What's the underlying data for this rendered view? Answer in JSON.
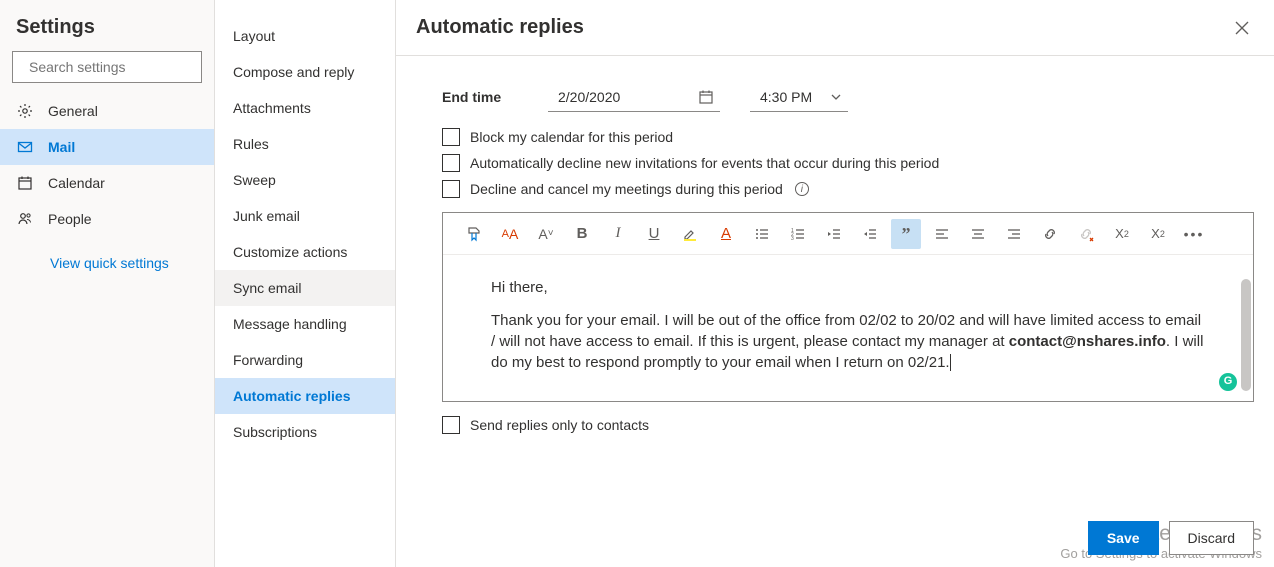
{
  "panel_left": {
    "title": "Settings",
    "search_placeholder": "Search settings",
    "categories": [
      {
        "label": "General"
      },
      {
        "label": "Mail"
      },
      {
        "label": "Calendar"
      },
      {
        "label": "People"
      }
    ],
    "quick_link": "View quick settings"
  },
  "panel_mid": {
    "items": [
      "Layout",
      "Compose and reply",
      "Attachments",
      "Rules",
      "Sweep",
      "Junk email",
      "Customize actions",
      "Sync email",
      "Message handling",
      "Forwarding",
      "Automatic replies",
      "Subscriptions"
    ]
  },
  "main": {
    "title": "Automatic replies",
    "end_label": "End time",
    "end_date": "2/20/2020",
    "end_time": "4:30 PM",
    "checks": {
      "block": "Block my calendar for this period",
      "decline_new": "Automatically decline new invitations for events that occur during this period",
      "decline_cancel": "Decline and cancel my meetings during this period"
    },
    "message": {
      "greeting": "Hi there,",
      "body1": "Thank you for your email. I will be out of the office from 02/02 to 20/02 and will have limited access to email / will not have access to email. If this is urgent, please contact my manager at ",
      "email": "contact@nshares.info",
      "body2": ". I will do my best to respond promptly to your email when I return on 02/21."
    },
    "send_only_contacts": "Send replies only to contacts",
    "save": "Save",
    "discard": "Discard"
  },
  "watermark": {
    "l1": "Activate Windows",
    "l2": "Go to Settings to activate Windows"
  }
}
